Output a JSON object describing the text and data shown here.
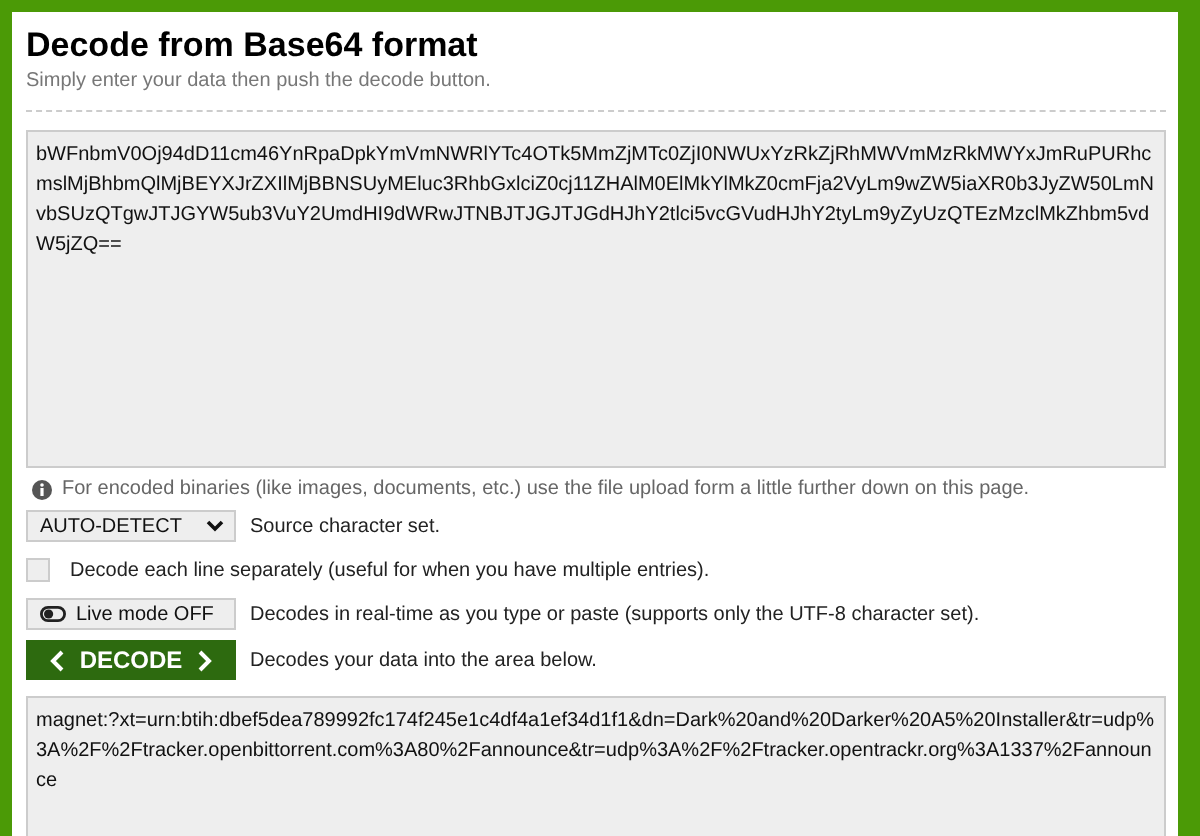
{
  "title": "Decode from Base64 format",
  "subtitle": "Simply enter your data then push the decode button.",
  "input": {
    "value": "bWFnbmV0Oj94dD11cm46YnRpaDpkYmVmNWRlYTc4OTk5MmZjMTc0ZjI0NWUxYzRkZjRhMWVmMzRkMWYxJmRuPURhcmslMjBhbmQlMjBEYXJrZXIlMjBBNSUyMEluc3RhbGxlciZ0cj11ZHAlM0ElMkYlMkZ0cmFja2VyLm9wZW5iaXR0b3JyZW50LmNvbSUzQTgwJTJGYW5ub3VuY2UmdHI9dWRwJTNBJTJGJTJGdHJhY2tlci5vcGVudHJhY2tyLm9yZyUzQTEzMzclMkZhbm5vdW5jZQ=="
  },
  "info": "For encoded binaries (like images, documents, etc.) use the file upload form a little further down on this page.",
  "charset": {
    "value": "AUTO-DETECT",
    "label": "Source character set."
  },
  "each_line": {
    "label": "Decode each line separately (useful for when you have multiple entries).",
    "checked": false
  },
  "live_mode": {
    "label": "Live mode OFF",
    "on": false,
    "description": "Decodes in real-time as you type or paste (supports only the UTF-8 character set)."
  },
  "decode": {
    "label": "DECODE",
    "description": "Decodes your data into the area below."
  },
  "output": {
    "value": "magnet:?xt=urn:btih:dbef5dea789992fc174f245e1c4df4a1ef34d1f1&dn=Dark%20and%20Darker%20A5%20Installer&tr=udp%3A%2F%2Ftracker.openbittorrent.com%3A80%2Fannounce&tr=udp%3A%2F%2Ftracker.opentrackr.org%3A1337%2Fannounce"
  }
}
